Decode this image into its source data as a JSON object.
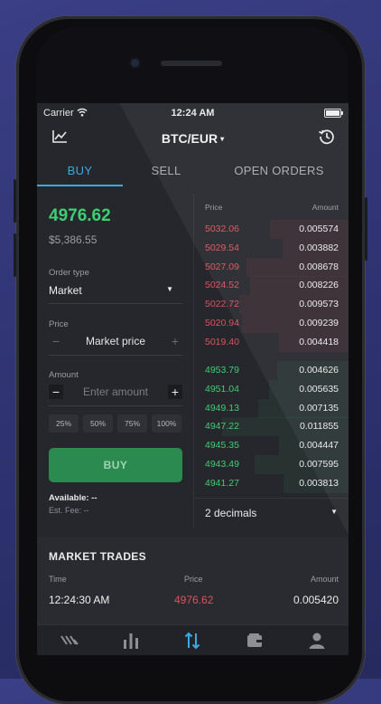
{
  "status_bar": {
    "carrier": "Carrier",
    "time": "12:24 AM"
  },
  "header": {
    "pair": "BTC/EUR",
    "caret": "▾"
  },
  "tabs": [
    {
      "label": "BUY",
      "active": true
    },
    {
      "label": "SELL",
      "active": false
    },
    {
      "label": "OPEN ORDERS",
      "active": false
    }
  ],
  "ticker": {
    "price": "4976.62",
    "fiat_price": "$5,386.55"
  },
  "order_form": {
    "order_type_label": "Order type",
    "order_type_value": "Market",
    "price_label": "Price",
    "price_value": "Market price",
    "amount_label": "Amount",
    "amount_placeholder": "Enter amount",
    "minus": "−",
    "plus": "+",
    "percentages": [
      "25%",
      "50%",
      "75%",
      "100%"
    ],
    "buy_button": "BUY",
    "available": "Available: --",
    "fee": "Est. Fee: --"
  },
  "order_book": {
    "price_header": "Price",
    "amount_header": "Amount",
    "asks": [
      {
        "price": "5032.06",
        "amount": "0.005574"
      },
      {
        "price": "5029.54",
        "amount": "0.003882"
      },
      {
        "price": "5027.09",
        "amount": "0.008678"
      },
      {
        "price": "5024.52",
        "amount": "0.008226"
      },
      {
        "price": "5022.72",
        "amount": "0.009573"
      },
      {
        "price": "5020.94",
        "amount": "0.009239"
      },
      {
        "price": "5019.40",
        "amount": "0.004418"
      }
    ],
    "bids": [
      {
        "price": "4953.79",
        "amount": "0.004626"
      },
      {
        "price": "4951.04",
        "amount": "0.005635"
      },
      {
        "price": "4949.13",
        "amount": "0.007135"
      },
      {
        "price": "4947.22",
        "amount": "0.011855"
      },
      {
        "price": "4945.35",
        "amount": "0.004447"
      },
      {
        "price": "4943.49",
        "amount": "0.007595"
      },
      {
        "price": "4941.27",
        "amount": "0.003813"
      }
    ],
    "decimals": "2 decimals"
  },
  "market_trades": {
    "title": "MARKET TRADES",
    "headers": {
      "time": "Time",
      "price": "Price",
      "amount": "Amount"
    },
    "rows": [
      {
        "time": "12:24:30 AM",
        "price": "4976.62",
        "amount": "0.005420"
      }
    ]
  },
  "tab_bar": {
    "icons": [
      "markets-icon",
      "chart-bars-icon",
      "trade-arrows-icon",
      "wallet-icon",
      "profile-icon"
    ],
    "active_index": 2
  },
  "colors": {
    "accent": "#3ea8e0",
    "buy": "#3fcf73",
    "sell": "#e0515d",
    "buy_button": "#2b8a4f"
  }
}
